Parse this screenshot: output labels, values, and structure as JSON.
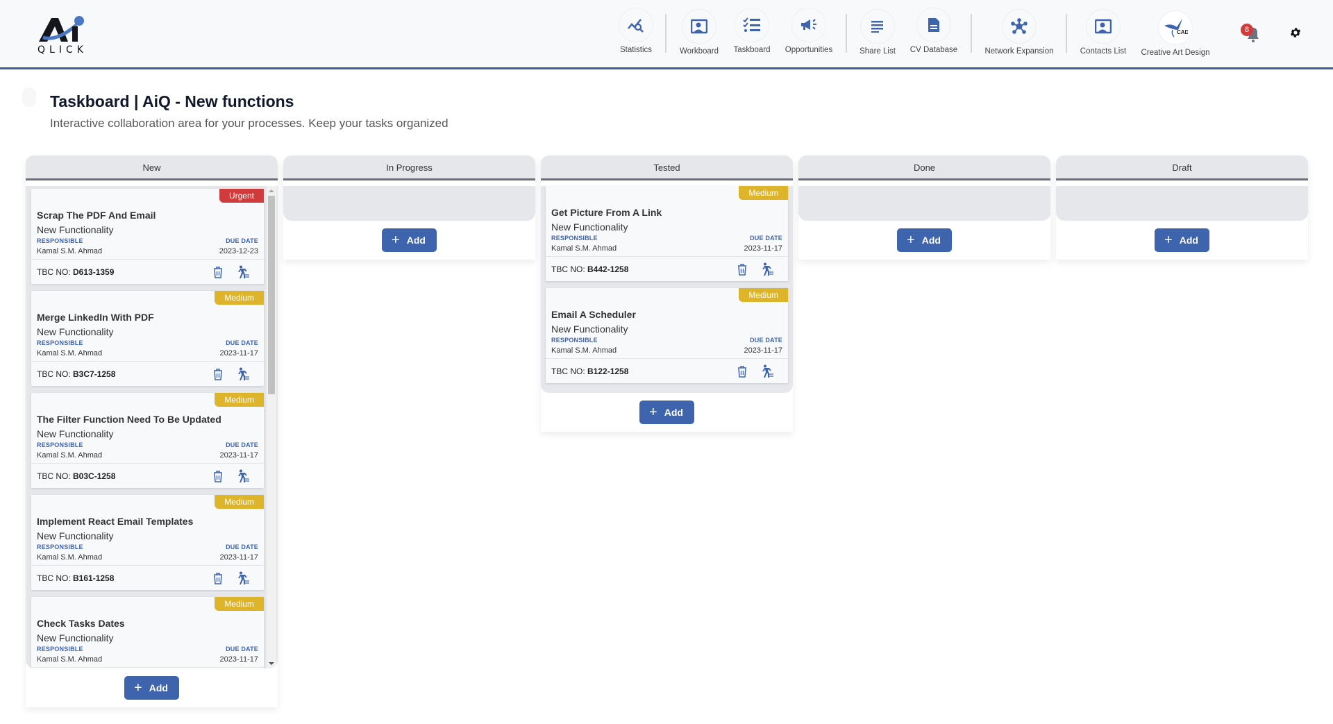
{
  "brand": {
    "logo_text": "QLICK"
  },
  "nav": [
    {
      "label": "Statistics",
      "icon": "chart-search-icon"
    },
    {
      "label": "Workboard",
      "icon": "person-board-icon"
    },
    {
      "label": "Taskboard",
      "icon": "checklist-icon"
    },
    {
      "label": "Opportunities",
      "icon": "megaphone-icon"
    },
    {
      "label": "Share List",
      "icon": "lines-list-icon"
    },
    {
      "label": "CV Database",
      "icon": "document-icon"
    },
    {
      "label": "Network Expansion",
      "icon": "network-icon"
    },
    {
      "label": "Contacts List",
      "icon": "contact-card-icon"
    },
    {
      "label": "Creative Art Design",
      "icon": "cad-logo-icon"
    }
  ],
  "notifications": {
    "count": "8"
  },
  "page": {
    "title": "Taskboard | AiQ - New functions",
    "subtitle": "Interactive collaboration area for your processes. Keep your tasks organized"
  },
  "labels": {
    "responsible": "RESPONSIBLE",
    "due_date": "DUE DATE",
    "tbc_prefix": "TBC NO:",
    "add": "Add"
  },
  "colors": {
    "accent": "#3e64ad",
    "urgent": "#d03b3b",
    "medium": "#deb52a"
  },
  "columns": [
    {
      "title": "New",
      "cards": [
        {
          "priority": "Urgent",
          "title": "Scrap The PDF And Email",
          "type": "New Functionality",
          "responsible": "Kamal S.M. Ahmad",
          "due": "2023-12-23",
          "tbc": "D613-1359"
        },
        {
          "priority": "Medium",
          "title": "Merge LinkedIn With PDF",
          "type": "New Functionality",
          "responsible": "Kamal S.M. Ahmad",
          "due": "2023-11-17",
          "tbc": "B3C7-1258"
        },
        {
          "priority": "Medium",
          "title": "The Filter Function Need To Be Updated",
          "type": "New Functionality",
          "responsible": "Kamal S.M. Ahmad",
          "due": "2023-11-17",
          "tbc": "B03C-1258"
        },
        {
          "priority": "Medium",
          "title": "Implement React Email Templates",
          "type": "New Functionality",
          "responsible": "Kamal S.M. Ahmad",
          "due": "2023-11-17",
          "tbc": "B161-1258"
        },
        {
          "priority": "Medium",
          "title": "Check Tasks Dates",
          "type": "New Functionality",
          "responsible": "Kamal S.M. Ahmad",
          "due": "2023-11-17",
          "tbc": ""
        }
      ]
    },
    {
      "title": "In Progress",
      "cards": []
    },
    {
      "title": "Tested",
      "cards": [
        {
          "priority": "Medium",
          "title": "Get Picture From A Link",
          "type": "New Functionality",
          "responsible": "Kamal S.M. Ahmad",
          "due": "2023-11-17",
          "tbc": "B442-1258"
        },
        {
          "priority": "Medium",
          "title": "Email A Scheduler",
          "type": "New Functionality",
          "responsible": "Kamal S.M. Ahmad",
          "due": "2023-11-17",
          "tbc": "B122-1258"
        }
      ]
    },
    {
      "title": "Done",
      "cards": []
    },
    {
      "title": "Draft",
      "cards": []
    }
  ]
}
